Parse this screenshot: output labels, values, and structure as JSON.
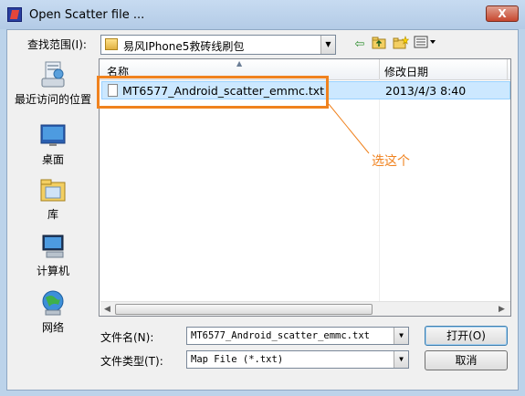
{
  "window": {
    "title": "Open Scatter file ...",
    "close_glyph": "X"
  },
  "lookin": {
    "label": "查找范围(I):",
    "value": "易风IPhone5救砖线刷包"
  },
  "toolbar": {
    "back_icon": "back-arrow-icon",
    "up_icon": "up-folder-icon",
    "new_folder_icon": "new-folder-icon",
    "view_menu_icon": "view-menu-icon"
  },
  "places": [
    {
      "label": "最近访问的位置",
      "icon": "recent-places-icon"
    },
    {
      "label": "桌面",
      "icon": "desktop-icon"
    },
    {
      "label": "库",
      "icon": "libraries-icon"
    },
    {
      "label": "计算机",
      "icon": "computer-icon"
    },
    {
      "label": "网络",
      "icon": "network-icon"
    }
  ],
  "file_list": {
    "columns": [
      "名称",
      "修改日期"
    ],
    "rows": [
      {
        "name": "MT6577_Android_scatter_emmc.txt",
        "modified": "2013/4/3 8:40"
      }
    ]
  },
  "filename": {
    "label": "文件名(N):",
    "value": "MT6577_Android_scatter_emmc.txt"
  },
  "filetype": {
    "label": "文件类型(T):",
    "value": "Map File (*.txt)"
  },
  "buttons": {
    "open": "打开(O)",
    "cancel": "取消"
  },
  "annotation": {
    "text": "选这个",
    "color": "#f0821e"
  },
  "colors": {
    "selection": "#cce8ff",
    "title_bar": "#bcd3ea",
    "close": "#c7472f"
  }
}
